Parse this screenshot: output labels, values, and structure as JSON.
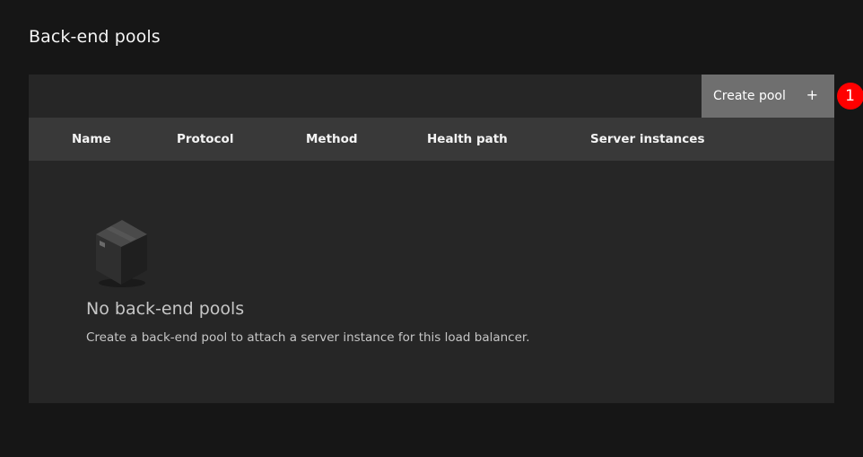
{
  "page": {
    "title": "Back-end pools"
  },
  "toolbar": {
    "create_label": "Create pool",
    "create_icon": "add-icon",
    "create_symbol": "+"
  },
  "annotation": {
    "badge_label": "1",
    "color": "#ff0000"
  },
  "table": {
    "columns": [
      "Name",
      "Protocol",
      "Method",
      "Health path",
      "Server instances"
    ]
  },
  "empty_state": {
    "icon": "box-icon",
    "title": "No back-end pools",
    "description": "Create a back-end pool to attach a server instance for this load balancer."
  },
  "colors": {
    "background": "#161616",
    "panel": "#262626",
    "header": "#393939",
    "button": "#6f6f6f"
  }
}
